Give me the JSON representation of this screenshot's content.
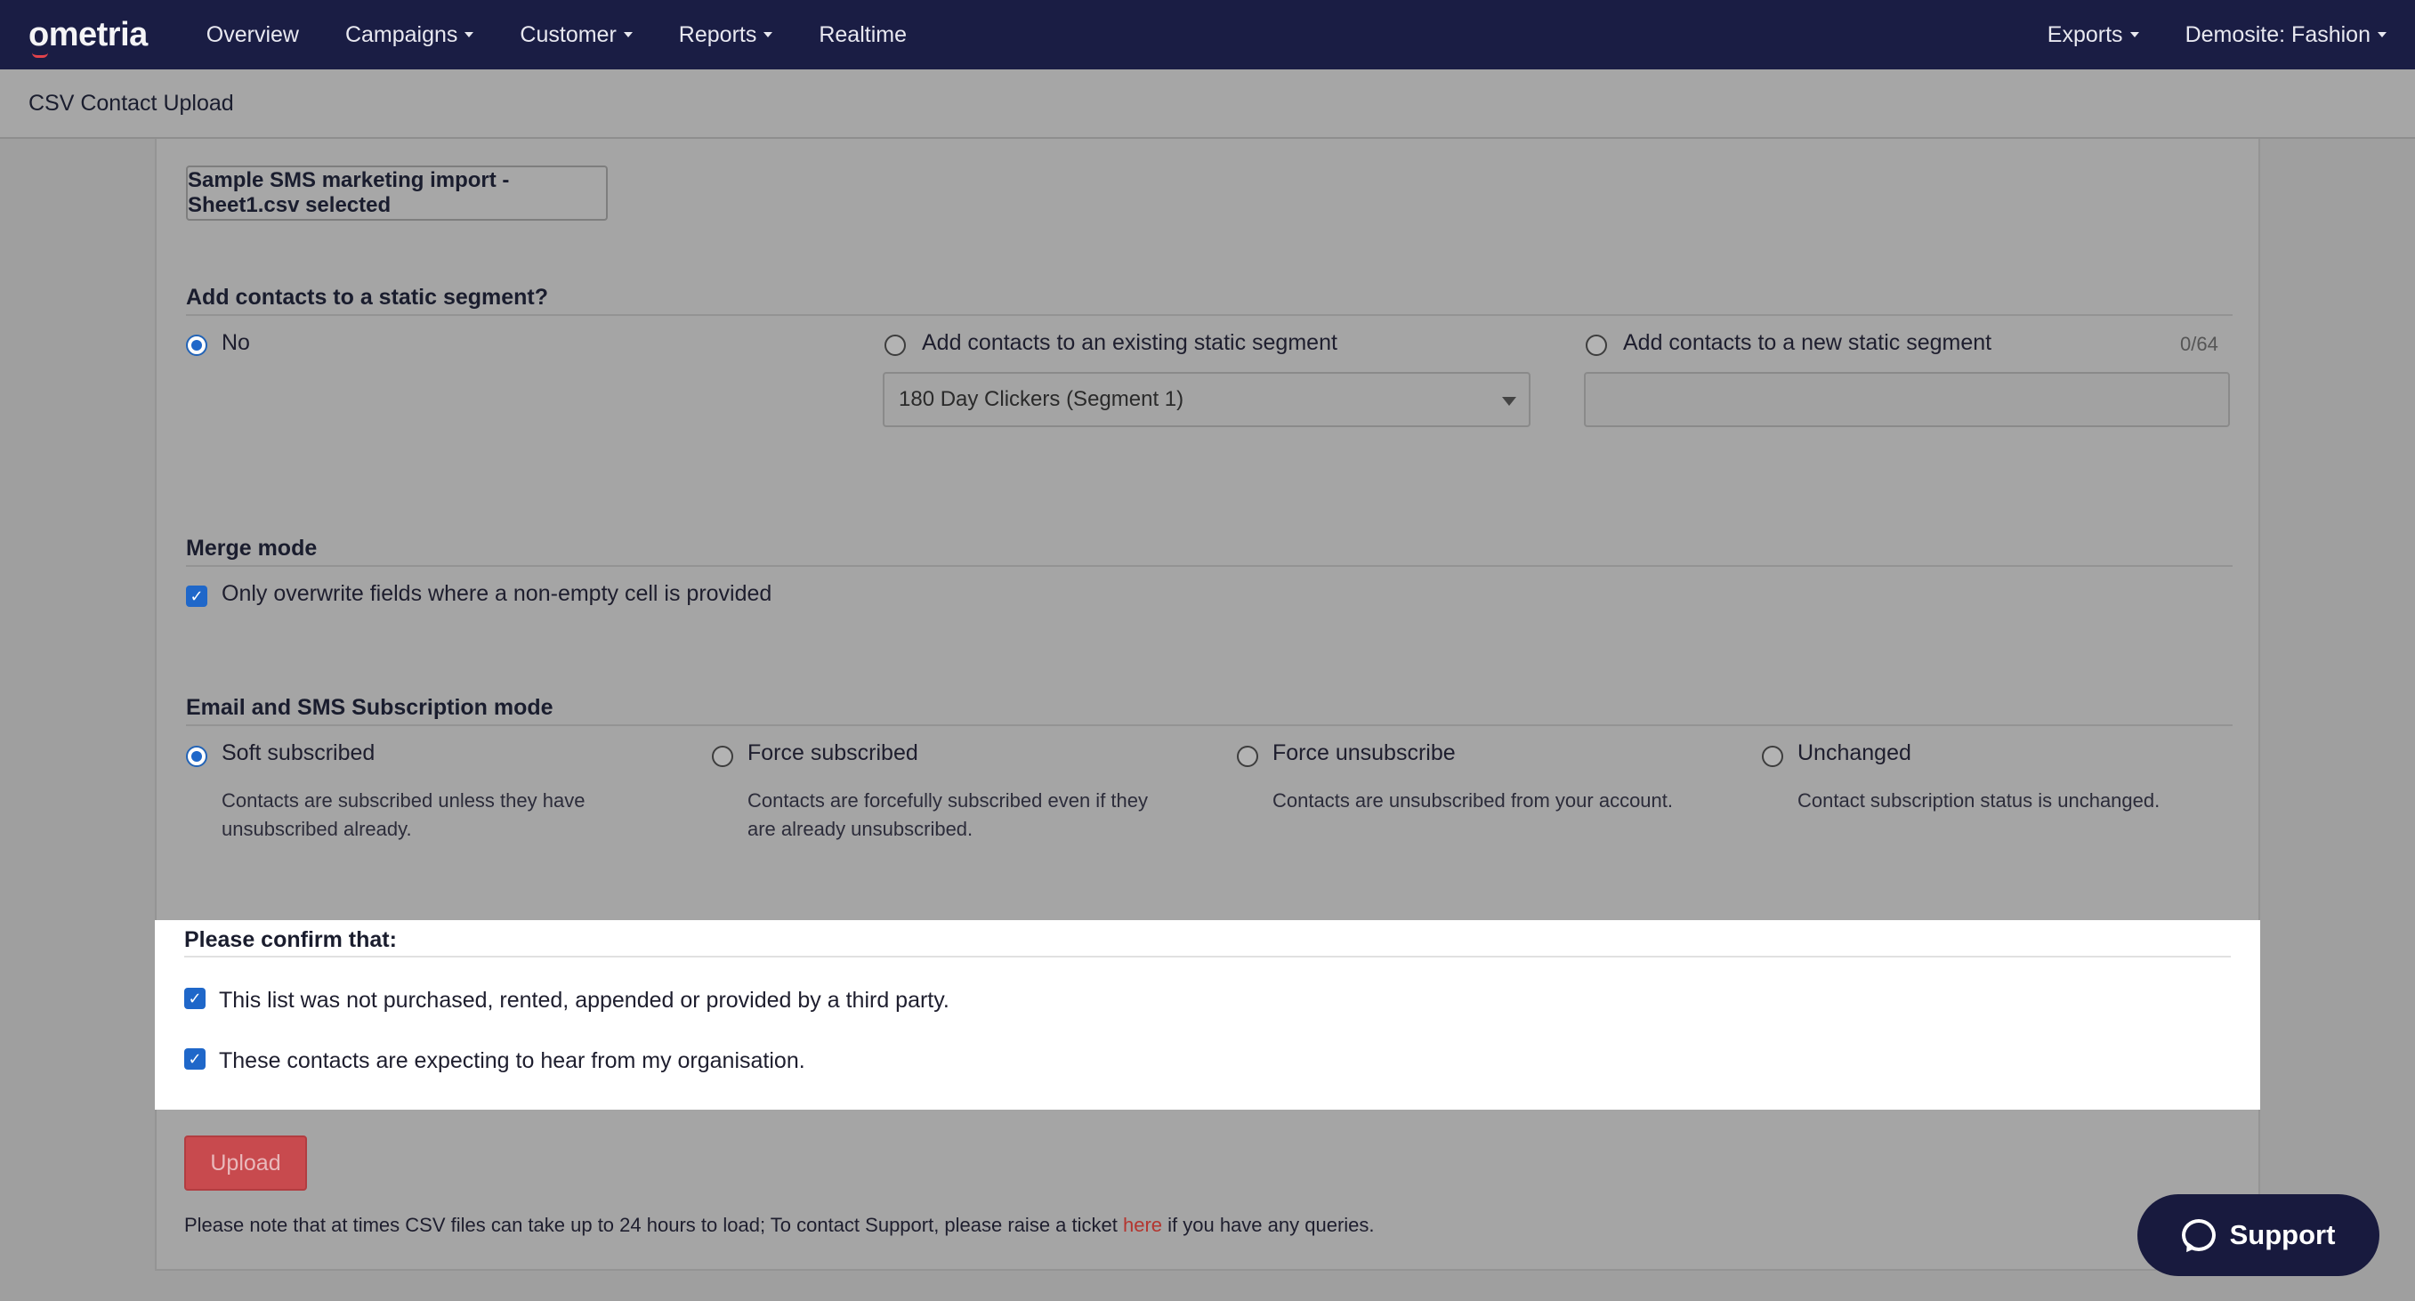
{
  "nav": {
    "logo": "ometria",
    "items": [
      "Overview",
      "Campaigns",
      "Customer",
      "Reports",
      "Realtime"
    ],
    "right": [
      "Exports",
      "Demosite: Fashion"
    ]
  },
  "page": {
    "title": "CSV Contact Upload"
  },
  "file": {
    "selected_label": "Sample SMS marketing import - Sheet1.csv selected"
  },
  "segment": {
    "title": "Add contacts to a static segment?",
    "options": [
      "No",
      "Add contacts to an existing static segment",
      "Add contacts to a new static segment"
    ],
    "selected": "No",
    "existing_value": "180 Day Clickers (Segment 1)",
    "new_name_value": "",
    "counter": "0/64"
  },
  "merge": {
    "title": "Merge mode",
    "checkbox_label": "Only overwrite fields where a non-empty cell is provided",
    "checked": true
  },
  "subscription": {
    "title": "Email and SMS Subscription mode",
    "selected": "Soft subscribed",
    "options": [
      {
        "label": "Soft subscribed",
        "desc": "Contacts are subscribed unless they have unsubscribed already."
      },
      {
        "label": "Force subscribed",
        "desc": "Contacts are forcefully subscribed even if they are already unsubscribed."
      },
      {
        "label": "Force unsubscribe",
        "desc": "Contacts are unsubscribed from your account."
      },
      {
        "label": "Unchanged",
        "desc": "Contact subscription status is unchanged."
      }
    ]
  },
  "confirm": {
    "title": "Please confirm that:",
    "items": [
      "This list was not purchased, rented, appended or provided by a third party.",
      "These contacts are expecting to hear from my organisation."
    ],
    "checked": [
      true,
      true
    ]
  },
  "upload": {
    "label": "Upload"
  },
  "note": {
    "before": "Please note that at times CSV files can take up to 24 hours to load; To contact Support, please raise a ticket ",
    "link": "here",
    "after": " if you have any queries."
  },
  "support": {
    "label": "Support"
  },
  "colors": {
    "nav_bg": "#1a1d44",
    "accent": "#1f67c9",
    "upload": "#c84a4e",
    "link": "#b4352f"
  }
}
